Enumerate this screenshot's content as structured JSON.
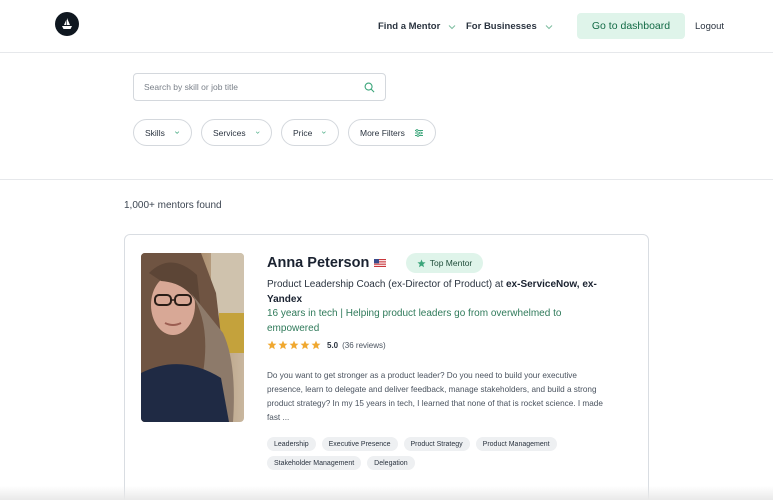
{
  "header": {
    "nav_find": "Find a Mentor",
    "nav_business": "For Businesses",
    "dashboard_button": "Go to dashboard",
    "logout": "Logout"
  },
  "search": {
    "placeholder": "Search by skill or job title"
  },
  "filters": {
    "skills": "Skills",
    "services": "Services",
    "price": "Price",
    "more": "More Filters"
  },
  "results": {
    "count": "1,000+ mentors found"
  },
  "mentor": {
    "name": "Anna Peterson",
    "badge": "Top Mentor",
    "role_prefix": "Product Leadership Coach (ex-Director of Product) at ",
    "role_companies": "ex-ServiceNow, ex-Yandex",
    "tagline": "16 years in tech | Helping product leaders go from overwhelmed to empowered",
    "rating": 5.0,
    "rating_text": "5.0",
    "reviews": "(36 reviews)",
    "bio": "Do you want to get stronger as a product leader? Do you need to build your executive presence, learn to delegate and deliver feedback, manage stakeholders, and build a strong product strategy? In my 15 years in tech, I learned that none of that is rocket science. I made fast ...",
    "tags": [
      "Leadership",
      "Executive Presence",
      "Product Strategy",
      "Product Management",
      "Stakeholder Management",
      "Delegation"
    ]
  },
  "colors": {
    "accent_green": "#126a45",
    "accent_bg": "#dff4ea",
    "tagline": "#2f7a5a",
    "star": "#f0a830"
  }
}
